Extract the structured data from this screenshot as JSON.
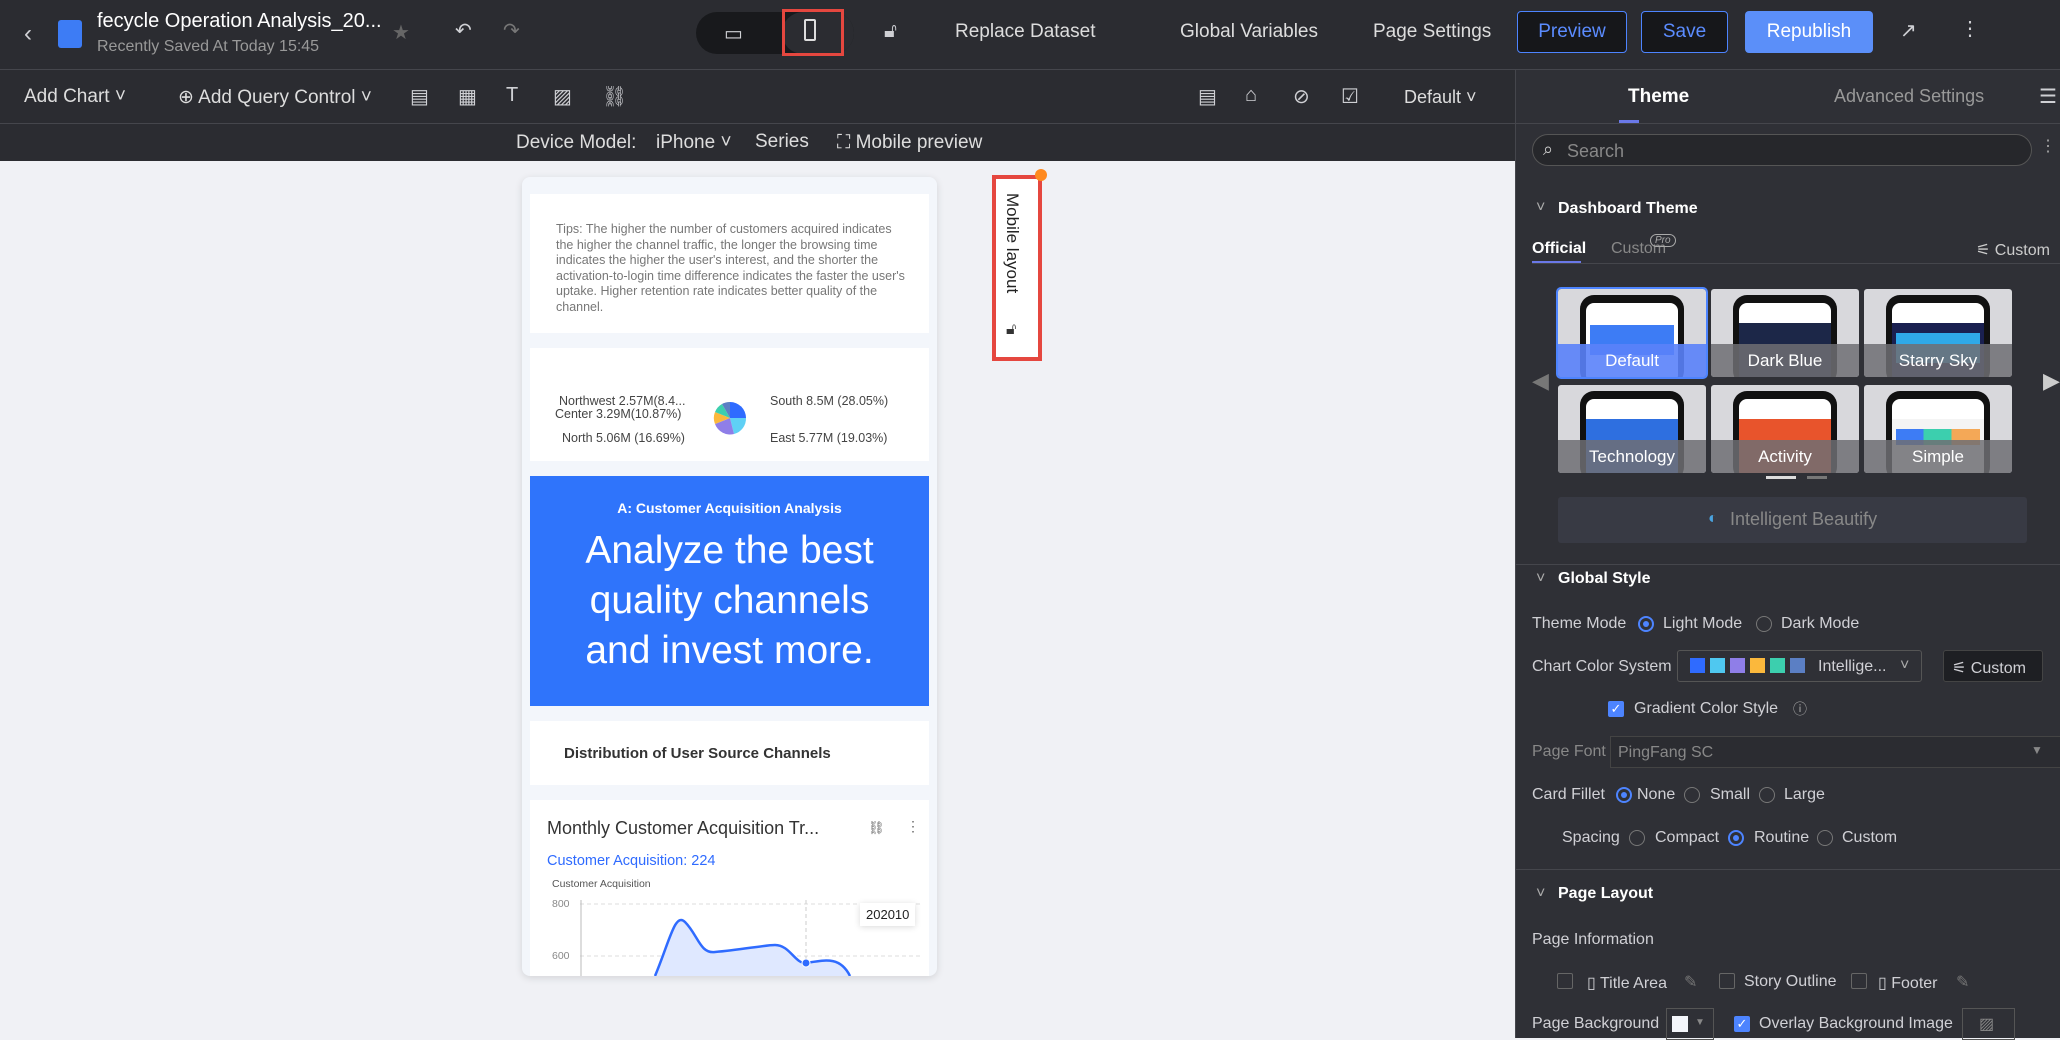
{
  "header": {
    "title": "fecycle Operation Analysis_20...",
    "saved": "Recently Saved At Today 15:45",
    "replace_dataset": "Replace Dataset",
    "global_variables": "Global Variables",
    "page_settings": "Page Settings",
    "preview": "Preview",
    "save": "Save",
    "republish": "Republish"
  },
  "toolbar": {
    "add_chart": "Add Chart",
    "add_query_control": "Add Query Control",
    "default": "Default"
  },
  "device": {
    "label": "Device Model:",
    "model": "iPhone",
    "series": "Series",
    "mobile_preview": "Mobile preview"
  },
  "mobile_layout_tab": "Mobile layout",
  "phone": {
    "tips": "Tips: The higher the number of customers acquired indicates the higher the channel traffic, the longer the browsing time indicates the higher the user's interest, and the shorter the activation-to-login time difference indicates the faster the user's uptake. Higher retention rate indicates better quality of the channel.",
    "pie_labels": {
      "northwest": "Northwest 2.57M(8.4...",
      "center": "Center 3.29M(10.87%)",
      "north": "North 5.06M (16.69%)",
      "south": "South 8.5M (28.05%)",
      "east": "East 5.77M (19.03%)"
    },
    "banner_subtitle": "A: Customer Acquisition Analysis",
    "banner_text": "Analyze the best quality channels and invest more.",
    "distribution_title": "Distribution of User Source Channels",
    "monthly_title": "Monthly Customer Acquisition Tr...",
    "monthly_value": "Customer Acquisition: 224",
    "y_axis_label": "Customer Acquisition",
    "y_ticks": [
      "800",
      "600"
    ],
    "tooltip": "202010"
  },
  "chart_data": {
    "type": "area",
    "title": "Monthly Customer Acquisition Tr...",
    "ylabel": "Customer Acquisition",
    "y_ticks": [
      800,
      600
    ],
    "tooltip_x": "202010",
    "highlight_value": 224
  },
  "panel": {
    "tabs": [
      "Theme",
      "Advanced Settings"
    ],
    "search_placeholder": "Search",
    "dashboard_theme": "Dashboard Theme",
    "official": "Official",
    "custom": "Custom",
    "pro": "Pro",
    "custom_btn": "Custom",
    "themes": [
      "Default",
      "Dark Blue",
      "Starry Sky",
      "Technology",
      "Activity",
      "Simple"
    ],
    "intelligent_beautify": "Intelligent Beautify",
    "global_style": "Global Style",
    "theme_mode": "Theme Mode",
    "light_mode": "Light Mode",
    "dark_mode": "Dark Mode",
    "chart_color_system": "Chart Color System",
    "color_system_value": "Intellige...",
    "color_custom": "Custom",
    "palette": [
      "#2f6bff",
      "#4fc8f0",
      "#8f7ee8",
      "#fbb83c",
      "#3ccfae",
      "#5b7fc4"
    ],
    "gradient": "Gradient Color Style",
    "page_font": "Page Font",
    "page_font_value": "PingFang SC",
    "card_fillet": "Card Fillet",
    "fillet_none": "None",
    "fillet_small": "Small",
    "fillet_large": "Large",
    "spacing": "Spacing",
    "compact": "Compact",
    "routine": "Routine",
    "spacing_custom": "Custom",
    "page_layout": "Page Layout",
    "page_information": "Page Information",
    "title_area": "Title Area",
    "story_outline": "Story Outline",
    "footer": "Footer",
    "page_background": "Page Background",
    "overlay_bg": "Overlay Background Image"
  }
}
